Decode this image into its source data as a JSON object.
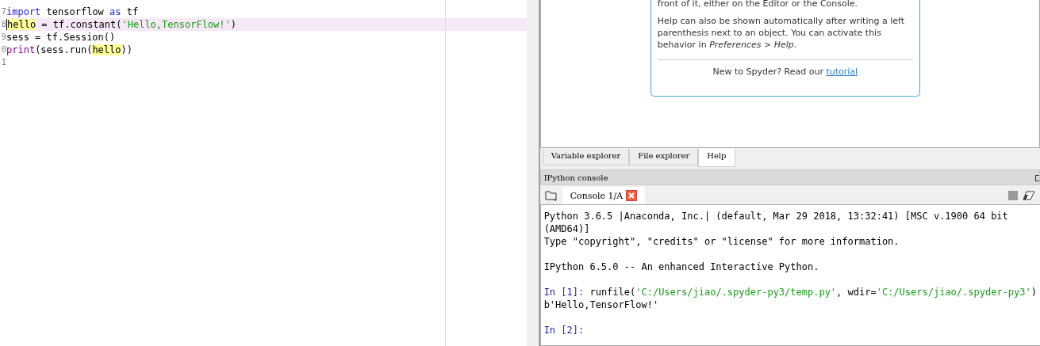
{
  "editor": {
    "lines": [
      {
        "number": "7",
        "current": false,
        "tokens": [
          {
            "kind": "keyword",
            "text": "import"
          },
          {
            "kind": "plain",
            "text": " tensorflow "
          },
          {
            "kind": "keyword",
            "text": "as"
          },
          {
            "kind": "plain",
            "text": " tf"
          }
        ]
      },
      {
        "number": "8",
        "current": true,
        "tokens": [
          {
            "kind": "match",
            "text": "hello"
          },
          {
            "kind": "plain",
            "text": " = tf.constant("
          },
          {
            "kind": "string",
            "text": "'Hello,TensorFlow!'"
          },
          {
            "kind": "plain",
            "text": ")"
          }
        ]
      },
      {
        "number": "9",
        "current": false,
        "tokens": [
          {
            "kind": "plain",
            "text": "sess = tf.Session()"
          }
        ]
      },
      {
        "number": "0",
        "current": false,
        "tokens": [
          {
            "kind": "builtin",
            "text": "print"
          },
          {
            "kind": "plain",
            "text": "(sess.run("
          },
          {
            "kind": "match",
            "text": "hello"
          },
          {
            "kind": "plain",
            "text": "))"
          }
        ]
      },
      {
        "number": "1",
        "current": false
      }
    ]
  },
  "help": {
    "paragraphs": [
      "front of it, either on the Editor or the Console.",
      "Help can also be shown automatically after writing a left parenthesis next to an object. You can activate this behavior in *Preferences > Help*."
    ],
    "footer_text": "New to Spyder? Read our",
    "footer_link": "tutorial"
  },
  "pane_tabs": [
    {
      "label": "Variable explorer",
      "selected": false
    },
    {
      "label": "File explorer",
      "selected": false
    },
    {
      "label": "Help",
      "selected": true
    }
  ],
  "console": {
    "title": "IPython console",
    "tab": "Console 1/A",
    "lines": [
      {
        "kind": "plain",
        "text": "Python 3.6.5 |Anaconda, Inc.| (default, Mar 29 2018, 13:32:41) [MSC v.1900 64 bit (AMD64)]"
      },
      {
        "kind": "plain",
        "text": "Type \"copyright\", \"credits\" or \"license\" for more information."
      },
      {
        "kind": "blank"
      },
      {
        "kind": "plain",
        "text": "IPython 6.5.0 -- An enhanced Interactive Python."
      },
      {
        "kind": "blank"
      },
      {
        "kind": "input",
        "prompt": "In [1]:",
        "tokens": [
          {
            "kind": "plain",
            "text": " runfile("
          },
          {
            "kind": "string",
            "text": "'C:/Users/jiao/.spyder-py3/temp.py'"
          },
          {
            "kind": "plain",
            "text": ", wdir="
          },
          {
            "kind": "string",
            "text": "'C:/Users/jiao/.spyder-py3'"
          },
          {
            "kind": "plain",
            "text": ")"
          }
        ]
      },
      {
        "kind": "plain",
        "text": "b'Hello,TensorFlow!'"
      },
      {
        "kind": "blank"
      },
      {
        "kind": "input",
        "prompt": "In [2]:"
      }
    ]
  }
}
